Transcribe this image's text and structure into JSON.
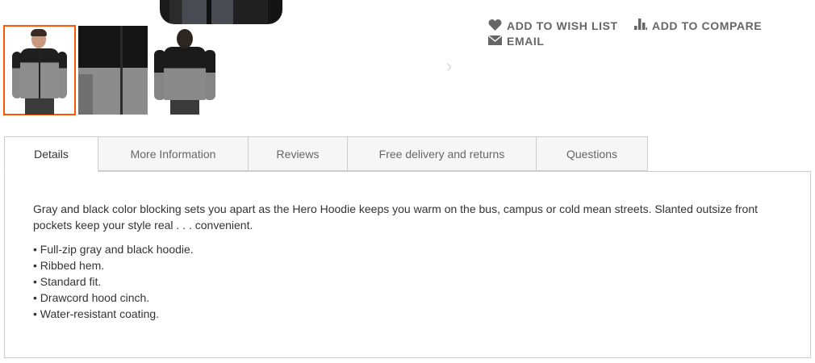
{
  "gallery": {
    "thumbnails": [
      {
        "name": "front view",
        "active": true
      },
      {
        "name": "detail view",
        "active": false
      },
      {
        "name": "back view",
        "active": false
      }
    ],
    "active_border_color": "#ff5501",
    "next_arrow_icon": "chevron-right-icon"
  },
  "actions": {
    "wish_list": {
      "label": "ADD TO WISH LIST",
      "icon": "heart-icon"
    },
    "compare": {
      "label": "ADD TO COMPARE",
      "icon": "bar-chart-icon"
    },
    "email": {
      "label": "EMAIL",
      "icon": "envelope-icon"
    }
  },
  "tabs": [
    {
      "label": "Details",
      "active": true
    },
    {
      "label": "More Information",
      "active": false
    },
    {
      "label": "Reviews",
      "active": false
    },
    {
      "label": "Free delivery and returns",
      "active": false
    },
    {
      "label": "Questions",
      "active": false
    }
  ],
  "details": {
    "description": "Gray and black color blocking sets you apart as the Hero Hoodie keeps you warm on the bus, campus or cold mean streets. Slanted outsize front pockets keep your style real . . . convenient.",
    "bullets": [
      "• Full-zip gray and black hoodie.",
      "• Ribbed hem.",
      "• Standard fit.",
      "• Drawcord hood cinch.",
      "• Water-resistant coating."
    ]
  }
}
